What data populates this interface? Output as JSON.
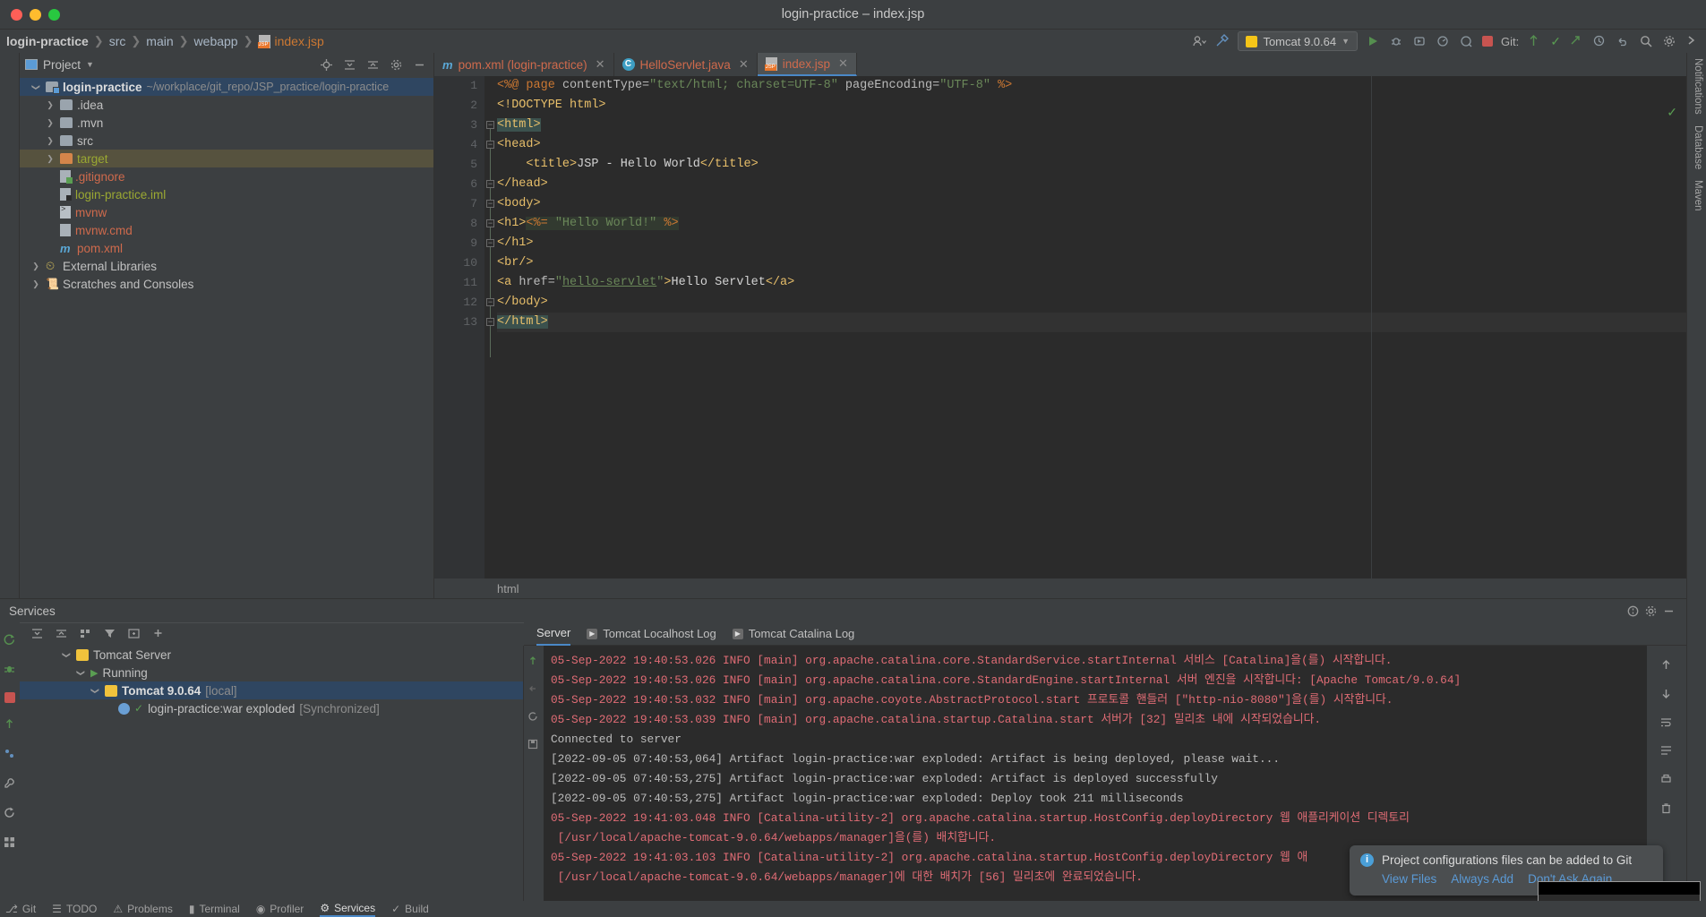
{
  "window": {
    "title": "login-practice – index.jsp"
  },
  "breadcrumb": {
    "items": [
      {
        "label": "login-practice",
        "style": "bold"
      },
      {
        "label": "src",
        "style": "plain"
      },
      {
        "label": "main",
        "style": "plain"
      },
      {
        "label": "webapp",
        "style": "plain"
      },
      {
        "label": "index.jsp",
        "style": "jsp"
      }
    ],
    "separator": "❯"
  },
  "toolbar": {
    "run_config": "Tomcat 9.0.64",
    "git_label": "Git:",
    "icons": [
      "user-select-icon",
      "build-hammer-icon",
      "run-icon",
      "debug-icon",
      "profile-icon",
      "more-run-icon",
      "stop-icon",
      "git-update-icon",
      "git-commit-icon",
      "git-push-icon",
      "git-history-icon",
      "undo-icon",
      "search-icon",
      "settings-icon",
      "hide-icon"
    ]
  },
  "project_panel": {
    "title": "Project",
    "header_buttons": [
      "locate-icon",
      "expand-all-icon",
      "collapse-all-icon",
      "gear-icon",
      "hide-icon"
    ],
    "tree": [
      {
        "indent": 0,
        "twisty": "expanded",
        "icon": "module-icon",
        "label": "login-practice",
        "style": "bold",
        "suffix": "~/workplace/git_repo/JSP_practice/login-practice",
        "selected": "blue"
      },
      {
        "indent": 1,
        "twisty": "collapsed",
        "icon": "folder-grey",
        "label": ".idea",
        "style": "plain",
        "suffix": ""
      },
      {
        "indent": 1,
        "twisty": "collapsed",
        "icon": "folder-grey",
        "label": ".mvn",
        "style": "plain",
        "suffix": ""
      },
      {
        "indent": 1,
        "twisty": "collapsed",
        "icon": "folder-grey",
        "label": "src",
        "style": "plain",
        "suffix": ""
      },
      {
        "indent": 1,
        "twisty": "collapsed",
        "icon": "folder-orange",
        "label": "target",
        "style": "olive",
        "suffix": "",
        "selected": "olive"
      },
      {
        "indent": 2,
        "twisty": "none",
        "icon": "gitignore-icon",
        "label": ".gitignore",
        "style": "red",
        "suffix": ""
      },
      {
        "indent": 2,
        "twisty": "none",
        "icon": "iml-icon",
        "label": "login-practice.iml",
        "style": "olive",
        "suffix": ""
      },
      {
        "indent": 2,
        "twisty": "none",
        "icon": "shell-icon",
        "label": "mvnw",
        "style": "red",
        "suffix": ""
      },
      {
        "indent": 2,
        "twisty": "none",
        "icon": "cmd-icon",
        "label": "mvnw.cmd",
        "style": "red",
        "suffix": ""
      },
      {
        "indent": 2,
        "twisty": "none",
        "icon": "maven-icon",
        "label": "pom.xml",
        "style": "red",
        "suffix": ""
      },
      {
        "indent": 0,
        "twisty": "collapsed",
        "icon": "library-icon",
        "label": "External Libraries",
        "style": "plain",
        "suffix": ""
      },
      {
        "indent": 0,
        "twisty": "collapsed",
        "icon": "scratches-icon",
        "label": "Scratches and Consoles",
        "style": "plain",
        "suffix": ""
      }
    ]
  },
  "editor": {
    "tabs": [
      {
        "label": "pom.xml (login-practice)",
        "icon": "maven-icon",
        "active": false
      },
      {
        "label": "HelloServlet.java",
        "icon": "java-class-icon",
        "active": false
      },
      {
        "label": "index.jsp",
        "icon": "jsp-icon",
        "active": true
      }
    ],
    "status_breadcrumb": "html",
    "line_numbers": [
      "1",
      "2",
      "3",
      "4",
      "5",
      "6",
      "7",
      "8",
      "9",
      "10",
      "11",
      "12",
      "13"
    ],
    "lines": [
      {
        "n": 1,
        "html": "<span class=\"t-kw\">&lt;%@</span> <span class=\"t-kw\">page</span> <span class=\"t-attr\">contentType=</span><span class=\"t-str\">\"text/html; charset=UTF-8\"</span> <span class=\"t-attr\">pageEncoding=</span><span class=\"t-str\">\"UTF-8\"</span> <span class=\"t-kw\">%&gt;</span>"
      },
      {
        "n": 2,
        "html": "<span class=\"t-tag\">&lt;!DOCTYPE html&gt;</span>"
      },
      {
        "n": 3,
        "html": "<span class=\"t-tag hl-tag\">&lt;html&gt;</span>"
      },
      {
        "n": 4,
        "html": "<span class=\"t-tag\">&lt;head&gt;</span>"
      },
      {
        "n": 5,
        "html": "    <span class=\"t-tag\">&lt;title&gt;</span><span class=\"t-white\">JSP - Hello World</span><span class=\"t-tag\">&lt;/title&gt;</span>"
      },
      {
        "n": 6,
        "html": "<span class=\"t-tag\">&lt;/head&gt;</span>"
      },
      {
        "n": 7,
        "html": "<span class=\"t-tag\">&lt;body&gt;</span>"
      },
      {
        "n": 8,
        "html": "<span class=\"t-tag\">&lt;h1&gt;</span><span class=\"hl-scr\"><span class=\"t-kw\">&lt;%=</span> <span class=\"t-str\">\"Hello World!\"</span> <span class=\"t-kw\">%&gt;</span></span>"
      },
      {
        "n": 9,
        "html": "<span class=\"t-tag\">&lt;/h1&gt;</span>"
      },
      {
        "n": 10,
        "html": "<span class=\"t-tag\">&lt;br/&gt;</span>"
      },
      {
        "n": 11,
        "html": "<span class=\"t-tag\">&lt;a </span><span class=\"t-attr\">href=</span><span class=\"t-str\">\"</span><span class=\"t-link\">hello-servlet</span><span class=\"t-str\">\"</span><span class=\"t-tag\">&gt;</span><span class=\"t-white\">Hello Servlet</span><span class=\"t-tag\">&lt;/a&gt;</span>"
      },
      {
        "n": 12,
        "html": "<span class=\"t-tag\">&lt;/body&gt;</span>"
      },
      {
        "n": 13,
        "html": "<span class=\"t-tag hl-tag\">&lt;/html&gt;</span>"
      }
    ]
  },
  "services": {
    "title": "Services",
    "toolbar_icons": [
      "rerun-icon",
      "expand-all-icon",
      "collapse-all-icon",
      "group-icon",
      "filter-icon",
      "new-tab-icon",
      "add-icon"
    ],
    "side_icons": [
      "rerun-icon",
      "debug-icon",
      "stop-icon",
      "deploy-icon",
      "settings-icon",
      "wrench-icon",
      "restart-icon",
      "grid-icon"
    ],
    "tree": [
      {
        "indent": 0,
        "twisty": "expanded",
        "icon": "tomcat-icon",
        "label": "Tomcat Server",
        "suffix": "",
        "selected": false
      },
      {
        "indent": 1,
        "twisty": "expanded",
        "icon": "play-icon",
        "label": "Running",
        "suffix": "",
        "selected": false
      },
      {
        "indent": 2,
        "twisty": "expanded",
        "icon": "tomcat-icon",
        "label": "Tomcat 9.0.64",
        "suffix": "[local]",
        "selected": true,
        "bold": true
      },
      {
        "indent": 3,
        "twisty": "none",
        "icon": "artifact-icon",
        "label": "login-practice:war exploded",
        "suffix": "[Synchronized]",
        "selected": false
      }
    ]
  },
  "console": {
    "tabs": [
      {
        "label": "Server",
        "icon": "",
        "active": true
      },
      {
        "label": "Tomcat Localhost Log",
        "icon": "run-icon",
        "active": false
      },
      {
        "label": "Tomcat Catalina Log",
        "icon": "run-icon",
        "active": false
      }
    ],
    "lines": [
      {
        "color": "red",
        "text": "05-Sep-2022 19:40:53.026 INFO [main] org.apache.catalina.core.StandardService.startInternal 서비스 [Catalina]을(를) 시작합니다."
      },
      {
        "color": "red",
        "text": "05-Sep-2022 19:40:53.026 INFO [main] org.apache.catalina.core.StandardEngine.startInternal 서버 엔진을 시작합니다: [Apache Tomcat/9.0.64]"
      },
      {
        "color": "red",
        "text": "05-Sep-2022 19:40:53.032 INFO [main] org.apache.coyote.AbstractProtocol.start 프로토콜 핸들러 [\"http-nio-8080\"]을(를) 시작합니다."
      },
      {
        "color": "red",
        "text": "05-Sep-2022 19:40:53.039 INFO [main] org.apache.catalina.startup.Catalina.start 서버가 [32] 밀리초 내에 시작되었습니다."
      },
      {
        "color": "grey",
        "text": "Connected to server"
      },
      {
        "color": "grey",
        "text": "[2022-09-05 07:40:53,064] Artifact login-practice:war exploded: Artifact is being deployed, please wait..."
      },
      {
        "color": "grey",
        "text": "[2022-09-05 07:40:53,275] Artifact login-practice:war exploded: Artifact is deployed successfully"
      },
      {
        "color": "grey",
        "text": "[2022-09-05 07:40:53,275] Artifact login-practice:war exploded: Deploy took 211 milliseconds"
      },
      {
        "color": "red",
        "text": "05-Sep-2022 19:41:03.048 INFO [Catalina-utility-2] org.apache.catalina.startup.HostConfig.deployDirectory 웹 애플리케이션 디렉토리"
      },
      {
        "color": "red",
        "text": " [/usr/local/apache-tomcat-9.0.64/webapps/manager]을(를) 배치합니다."
      },
      {
        "color": "red",
        "text": "05-Sep-2022 19:41:03.103 INFO [Catalina-utility-2] org.apache.catalina.startup.HostConfig.deployDirectory 웹 애"
      },
      {
        "color": "red",
        "text": " [/usr/local/apache-tomcat-9.0.64/webapps/manager]에 대한 배치가 [56] 밀리초에 완료되었습니다."
      }
    ],
    "right_icons": [
      "scroll-up-icon",
      "scroll-down-icon",
      "soft-wrap-icon",
      "scroll-end-icon",
      "print-icon",
      "trash-icon"
    ]
  },
  "notification": {
    "message": "Project configurations files can be added to Git",
    "links": [
      "View Files",
      "Always Add",
      "Don't Ask Again"
    ],
    "icon": "info-icon"
  },
  "right_strip": {
    "tabs": [
      "Notifications",
      "Database",
      "Maven"
    ]
  },
  "left_strip": {
    "tabs": []
  },
  "statusbar": {
    "items": [
      "Git",
      "TODO",
      "Problems",
      "Terminal",
      "Profiler",
      "Services",
      "Build"
    ]
  },
  "colors": {
    "accent": "#4a88c7",
    "selection": "#2f4661",
    "olive_selection": "#56523e",
    "error_red": "#e06c75",
    "green": "#5a9e52",
    "orange": "#cc7832"
  }
}
